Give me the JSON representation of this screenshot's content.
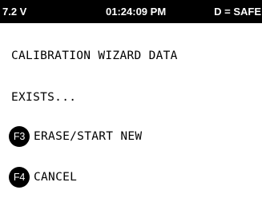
{
  "status_bar": {
    "voltage": "7.2 V",
    "time": "01:24:09 PM",
    "mode": "D = SAFE"
  },
  "message": {
    "line1": "CALIBRATION WIZARD DATA",
    "line2": "EXISTS..."
  },
  "options": [
    {
      "key": "F3",
      "label": "ERASE/START NEW"
    },
    {
      "key": "F4",
      "label": "CANCEL"
    }
  ],
  "colors": {
    "background": "#ffffff",
    "status_bar": "#000000",
    "text": "#000000",
    "badge": "#000000"
  }
}
